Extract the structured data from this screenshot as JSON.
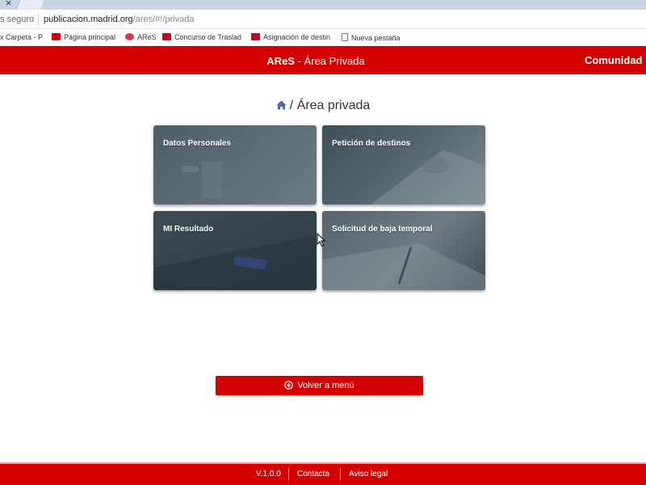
{
  "browser": {
    "close_glyph": "×",
    "secure_text": "s seguro",
    "url_host": "publicacion.madrid.org",
    "url_path": "/ares/#!/privada",
    "bookmarks": [
      {
        "label": "x Carpeta - P",
        "icon": "none"
      },
      {
        "label": "Página principal",
        "icon": "madrid-flag-icon"
      },
      {
        "label": "AReS",
        "icon": "ares-icon"
      },
      {
        "label": "Concurso de Traslad",
        "icon": "madrid-flag-icon"
      },
      {
        "label": "Asignación de destin",
        "icon": "madrid-flag-icon"
      },
      {
        "label": "Nueva pestaña",
        "icon": "page-icon"
      }
    ]
  },
  "header": {
    "app_name": "AReS",
    "separator": " - ",
    "section": "Área Privada",
    "right_text": "Comunidad"
  },
  "page": {
    "title": "/ Área privada",
    "home_icon": "home-icon"
  },
  "tiles": [
    {
      "label": "Datos Personales"
    },
    {
      "label": "Petición de destinos"
    },
    {
      "label": "MI Resultado"
    },
    {
      "label": "Solicitud de baja temporal"
    }
  ],
  "back_button": {
    "label": "Volver a menú",
    "icon": "arrow-circle-left-icon"
  },
  "footer": {
    "version": "V.1.0.0",
    "contact": "Contacta",
    "legal": "Aviso legal"
  },
  "colors": {
    "brand_red": "#d40000"
  }
}
